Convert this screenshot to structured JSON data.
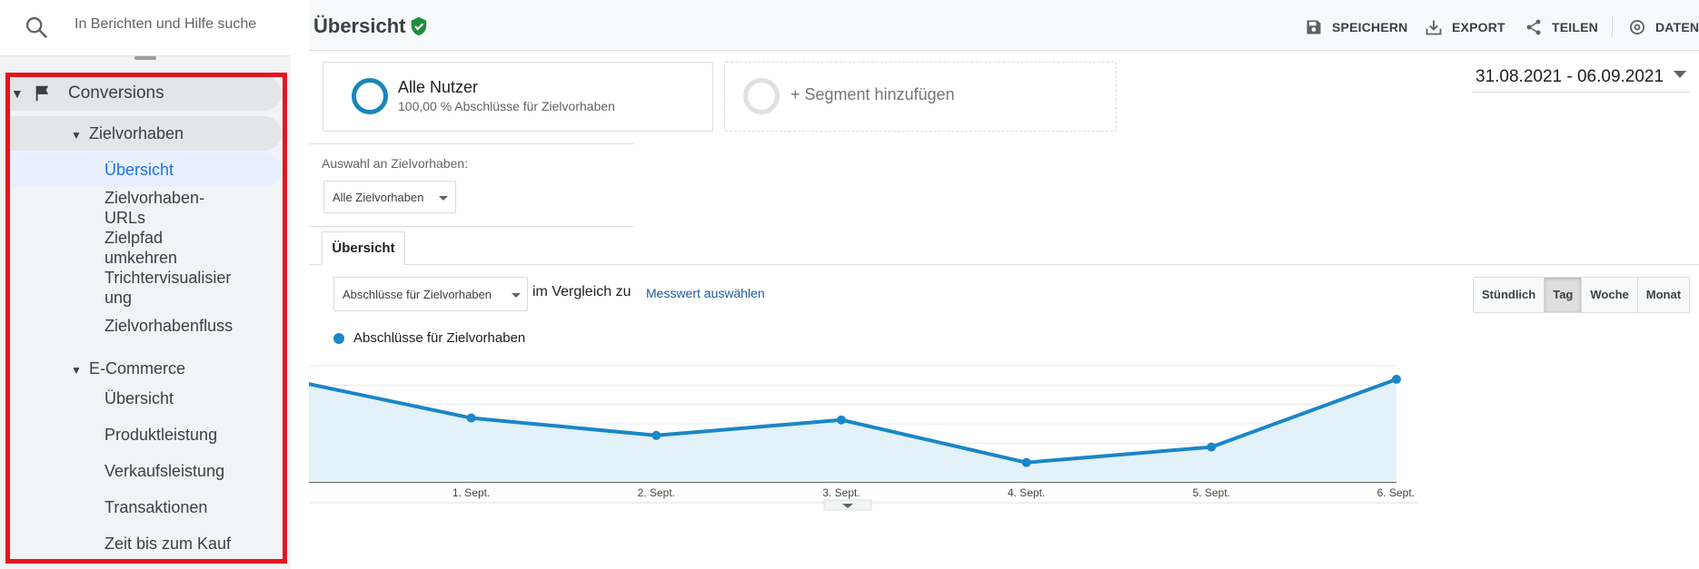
{
  "search": {
    "placeholder": "In Berichten und Hilfe suche"
  },
  "sidebar": {
    "conversions": "Conversions",
    "zielvorhaben": "Zielvorhaben",
    "zv_items": [
      {
        "label": "Übersicht"
      },
      {
        "label": "Zielvorhaben-\nURLs"
      },
      {
        "label": "Zielpfad\numkehren"
      },
      {
        "label": "Trichtervisualisier\nung"
      },
      {
        "label": "Zielvorhabenfluss"
      }
    ],
    "ecommerce": "E-Commerce",
    "ec_items": [
      {
        "label": "Übersicht"
      },
      {
        "label": "Produktleistung"
      },
      {
        "label": "Verkaufsleistung"
      },
      {
        "label": "Transaktionen"
      },
      {
        "label": "Zeit bis zum Kauf"
      }
    ]
  },
  "header": {
    "title": "Übersicht",
    "save": "SPEICHERN",
    "export": "EXPORT",
    "share": "TEILEN",
    "data": "DATEN"
  },
  "segments": {
    "all_name": "Alle Nutzer",
    "all_desc": "100,00 % Abschlüsse für Zielvorhaben",
    "add": "+ Segment hinzufügen"
  },
  "date_range": "31.08.2021 - 06.09.2021",
  "goal_selection": {
    "label": "Auswahl an Zielvorhaben:",
    "value": "Alle Zielvorhaben"
  },
  "tabs": [
    {
      "label": "Übersicht"
    }
  ],
  "metric": {
    "value": "Abschlüsse für Zielvorhaben",
    "compare_text": "im Vergleich zu",
    "pick_link": "Messwert auswählen"
  },
  "granularity": {
    "options": [
      "Stündlich",
      "Tag",
      "Woche",
      "Monat"
    ],
    "active": "Tag"
  },
  "colors": {
    "line": "#1a86c8",
    "area": "#e3f1f8",
    "highlight": "#e3161e"
  },
  "chart_data": {
    "type": "area",
    "series": [
      {
        "name": "Abschlüsse für Zielvorhaben",
        "values": [
          53,
          33,
          24,
          32,
          10,
          18,
          53
        ]
      }
    ],
    "categories": [
      "...",
      "1. Sept.",
      "2. Sept.",
      "3. Sept.",
      "4. Sept.",
      "5. Sept.",
      "6. Sept."
    ],
    "yticks": [
      "20",
      "40",
      "60"
    ],
    "ylim": [
      0,
      60
    ]
  }
}
